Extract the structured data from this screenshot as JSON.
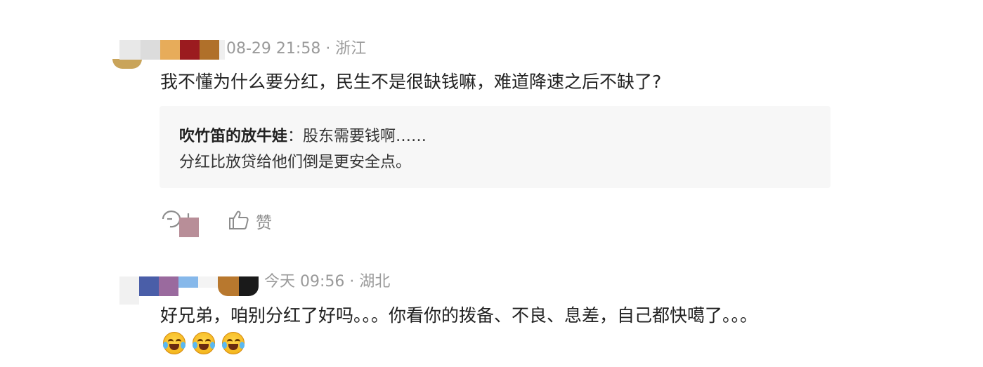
{
  "comment1": {
    "meta": "08-29 21:58 · 浙江",
    "text": "我不懂为什么要分红，民生不是很缺钱嘛，难道降速之后不缺了?",
    "reply": {
      "author": "吹竹笛的放牛娃",
      "separator": "：",
      "line1": "股东需要钱啊……",
      "line2": "分红比放贷给他们倒是更安全点。"
    },
    "actions": {
      "comment_icon": "comment-icon",
      "like_icon": "thumbs-up-icon",
      "like_label": "赞"
    }
  },
  "comment2": {
    "meta": "今天 09:56 · 湖北",
    "text": "好兄弟，咱别分红了好吗。。。你看你的拨备、不良、息差，自己都快噶了。。。",
    "emojis": [
      "laughing-crying-emoji",
      "laughing-crying-emoji",
      "laughing-crying-emoji"
    ]
  },
  "colors": {
    "meta": "#9a9a9a",
    "text": "#222222",
    "quote_bg": "#f7f7f7",
    "action": "#8c8c8c"
  }
}
